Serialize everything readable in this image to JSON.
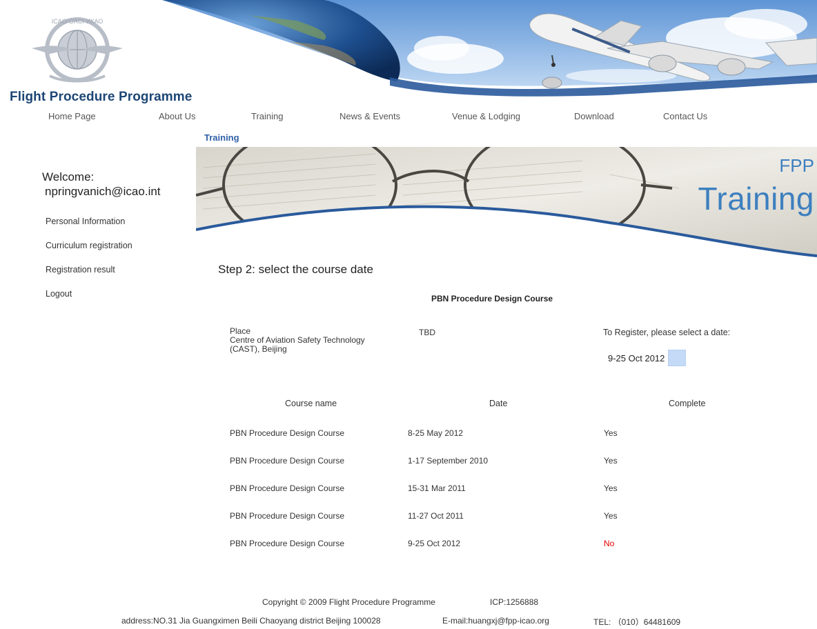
{
  "site": {
    "title": "Flight Procedure Programme"
  },
  "nav": [
    {
      "label": "Home Page"
    },
    {
      "label": "About Us"
    },
    {
      "label": "Training"
    },
    {
      "label": "News & Events"
    },
    {
      "label": "Venue & Lodging"
    },
    {
      "label": "Download"
    },
    {
      "label": "Contact Us"
    }
  ],
  "breadcrumb": "Training",
  "banner": {
    "small": "FPP",
    "large": "Training"
  },
  "sidebar": {
    "welcome": "Welcome:",
    "email": "npringvanich@icao.int",
    "links": [
      {
        "label": "Personal Information"
      },
      {
        "label": "Curriculum registration"
      },
      {
        "label": "Registration result"
      },
      {
        "label": "Logout"
      }
    ]
  },
  "main": {
    "step_title": "Step 2: select the course date",
    "course_title": "PBN Procedure Design Course",
    "place": {
      "label": "Place",
      "line1": "Centre of Aviation Safety Technology",
      "line2": "(CAST), Beijing"
    },
    "tbd": "TBD",
    "register_label": "To Register, please select a date:",
    "date_option": "9-25 Oct 2012",
    "table": {
      "headers": [
        "Course name",
        "Date",
        "Complete"
      ],
      "rows": [
        [
          "PBN Procedure Design Course",
          "8-25 May 2012",
          "Yes"
        ],
        [
          "PBN Procedure Design Course",
          "1-17 September 2010",
          "Yes"
        ],
        [
          "PBN Procedure Design Course",
          "15-31 Mar 2011",
          "Yes"
        ],
        [
          "PBN Procedure Design Course",
          "11-27 Oct 2011",
          "Yes"
        ],
        [
          "PBN Procedure Design Course",
          "9-25 Oct 2012",
          "No"
        ]
      ]
    }
  },
  "footer": {
    "copyright": "Copyright © 2009 Flight Procedure Programme",
    "icp": "ICP:1256888",
    "address": "address:NO.31 Jia Guangximen Beili Chaoyang district Beijing 100028",
    "email": "E-mail:huangxj@fpp-icao.org",
    "tel": "TEL: （010）64481609"
  },
  "colors": {
    "title_blue": "#1d4675",
    "link_blue": "#2f5fa7",
    "no_red": "#e00000",
    "banner_text": "#3d7fbf"
  }
}
